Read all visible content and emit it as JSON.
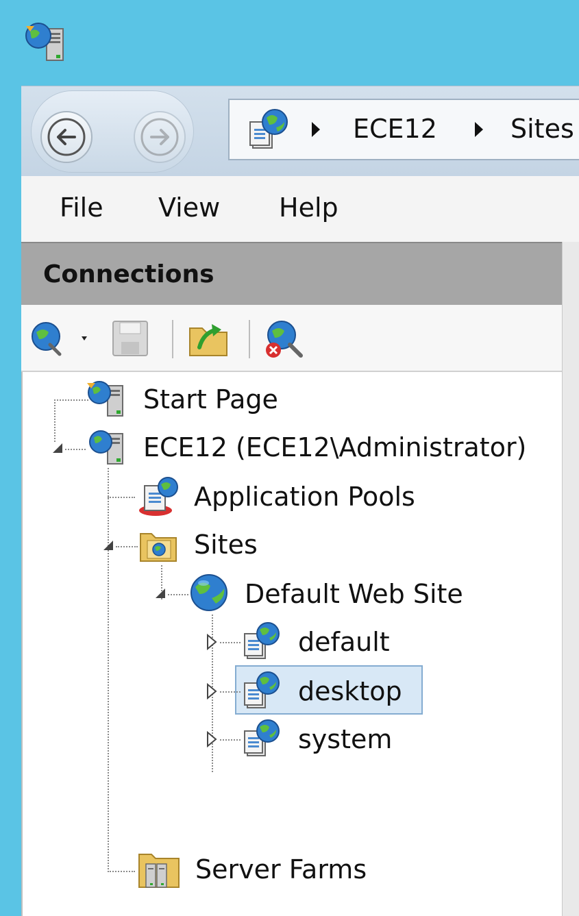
{
  "address": {
    "crumbs": [
      "ECE12",
      "Sites"
    ]
  },
  "menu": {
    "file": "File",
    "view": "View",
    "help": "Help"
  },
  "connections": {
    "title": "Connections"
  },
  "tree": {
    "items": [
      {
        "label": "Start Page",
        "icon": "start-page-icon"
      },
      {
        "label": "ECE12 (ECE12\\Administrator)",
        "icon": "server-icon",
        "expanded": true
      },
      {
        "label": "Application Pools",
        "icon": "application-pools-icon"
      },
      {
        "label": "Sites",
        "icon": "sites-folder-icon",
        "expanded": true
      },
      {
        "label": "Default Web Site",
        "icon": "globe-icon",
        "expanded": true
      },
      {
        "label": "default",
        "icon": "web-app-icon",
        "expanded": false
      },
      {
        "label": "desktop",
        "icon": "web-app-icon",
        "expanded": false,
        "selected": true
      },
      {
        "label": "system",
        "icon": "web-app-icon",
        "expanded": false
      },
      {
        "label": "Server Farms",
        "icon": "server-farms-icon"
      }
    ]
  },
  "colors": {
    "title_bar": "#5ac4e5",
    "selection": "#d8e8f6",
    "panel_header": "#a6a6a6"
  }
}
